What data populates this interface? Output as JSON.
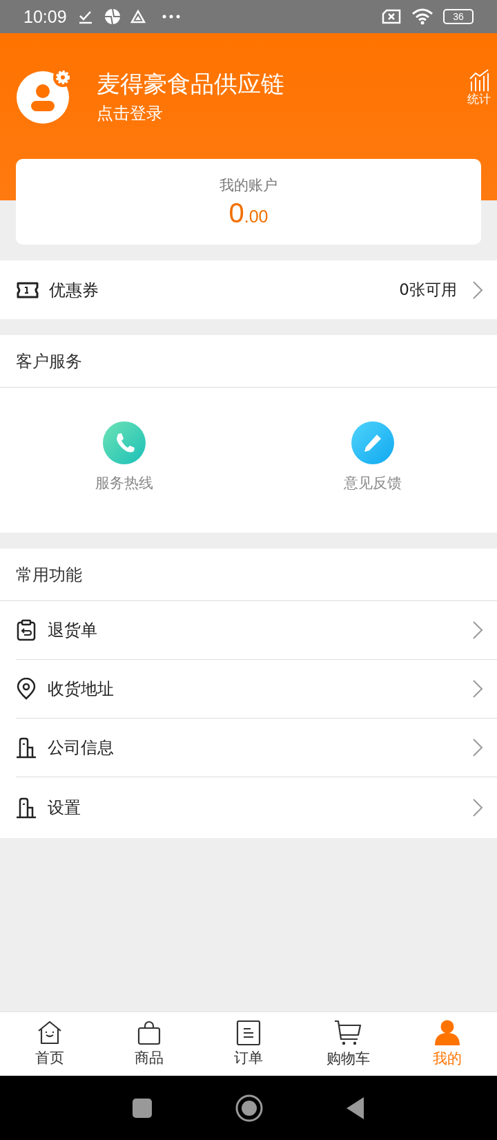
{
  "status_bar": {
    "time": "10:09",
    "battery": "36"
  },
  "header": {
    "title": "麦得豪食品供应链",
    "subtitle": "点击登录",
    "stats_label": "统计"
  },
  "account": {
    "label": "我的账户",
    "amount_integer": "0",
    "amount_decimal": ".00"
  },
  "coupon": {
    "label": "优惠券",
    "value": "0张可用"
  },
  "customer_service": {
    "title": "客户服务",
    "items": [
      {
        "label": "服务热线",
        "kind": "phone"
      },
      {
        "label": "意见反馈",
        "kind": "edit"
      }
    ]
  },
  "common_functions": {
    "title": "常用功能",
    "items": [
      {
        "label": "退货单",
        "kind": "return"
      },
      {
        "label": "收货地址",
        "kind": "location"
      },
      {
        "label": "公司信息",
        "kind": "building"
      },
      {
        "label": "设置",
        "kind": "building"
      }
    ]
  },
  "tab_bar": [
    {
      "label": "首页",
      "kind": "home",
      "selected": false
    },
    {
      "label": "商品",
      "kind": "bag",
      "selected": false
    },
    {
      "label": "订单",
      "kind": "list",
      "selected": false
    },
    {
      "label": "购物车",
      "kind": "cart",
      "selected": false
    },
    {
      "label": "我的",
      "kind": "person",
      "selected": true
    }
  ]
}
